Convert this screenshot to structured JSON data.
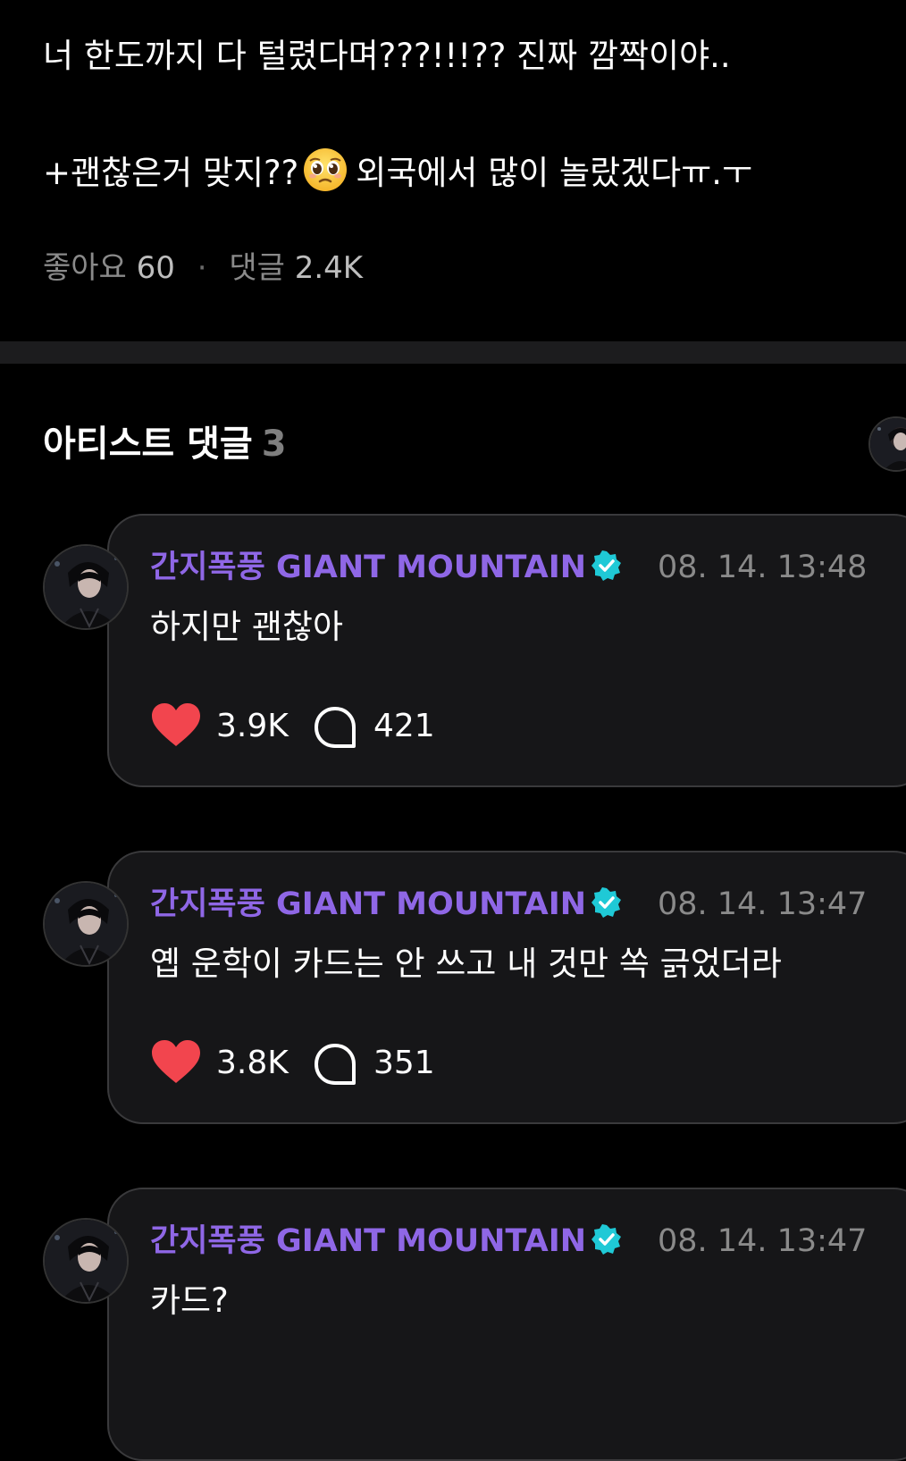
{
  "post": {
    "line1": "너 한도까지 다 털렸다며???!!!?? 진짜 깜짝이야..",
    "line2_before_emoji": "+괜찮은거 맞지??",
    "line2_after_emoji": "외국에서 많이 놀랐겠다ㅠ.ㅜ",
    "emoji_icon": "pleading-face-emoji",
    "likes_label": "좋아요",
    "likes_count": "60",
    "separator": "·",
    "comments_label": "댓글",
    "comments_count": "2.4K"
  },
  "artist_section": {
    "title": "아티스트 댓글",
    "count": "3"
  },
  "comments": [
    {
      "author": "간지폭풍 GIANT MOUNTAIN",
      "time": "08. 14. 13:48",
      "text": "하지만 괜찮아",
      "likes": "3.9K",
      "replies": "421"
    },
    {
      "author": "간지폭풍 GIANT MOUNTAIN",
      "time": "08. 14. 13:47",
      "text": "옙 운학이 카드는 안 쓰고 내 것만 쏙 긁었더라",
      "likes": "3.8K",
      "replies": "351"
    },
    {
      "author": "간지폭풍 GIANT MOUNTAIN",
      "time": "08. 14. 13:47",
      "text": "카드?",
      "likes": "",
      "replies": ""
    }
  ],
  "colors": {
    "author": "#8f67e6",
    "verified": "#1fc9d6",
    "heart": "#f2454e",
    "bubble": "#161618"
  }
}
